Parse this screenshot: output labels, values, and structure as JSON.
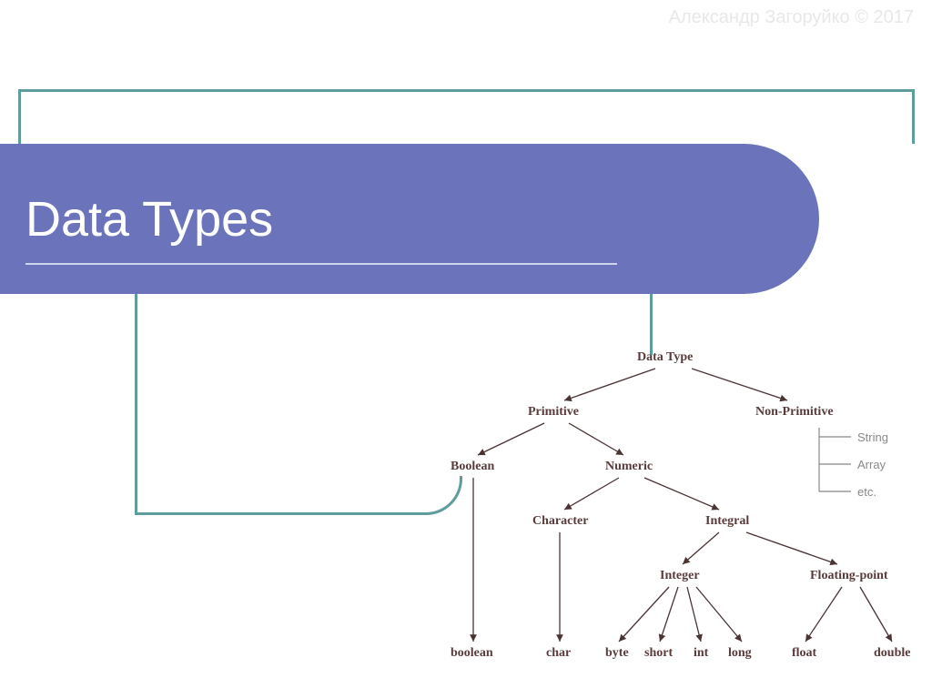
{
  "watermark": "Александр Загоруйко © 2017",
  "title": "Data Types",
  "diagram": {
    "root": "Data Type",
    "primitive": "Primitive",
    "nonprimitive": "Non-Primitive",
    "boolean_cat": "Boolean",
    "numeric": "Numeric",
    "character": "Character",
    "integral": "Integral",
    "integer": "Integer",
    "floating": "Floating-point",
    "leaf_boolean": "boolean",
    "leaf_char": "char",
    "leaf_byte": "byte",
    "leaf_short": "short",
    "leaf_int": "int",
    "leaf_long": "long",
    "leaf_float": "float",
    "leaf_double": "double",
    "np_string": "String",
    "np_array": "Array",
    "np_etc": "etc."
  },
  "chart_data": {
    "type": "tree",
    "title": "Data Types",
    "root": "Data Type",
    "children": [
      {
        "name": "Primitive",
        "children": [
          {
            "name": "Boolean",
            "children": [
              {
                "name": "boolean"
              }
            ]
          },
          {
            "name": "Numeric",
            "children": [
              {
                "name": "Character",
                "children": [
                  {
                    "name": "char"
                  }
                ]
              },
              {
                "name": "Integral",
                "children": [
                  {
                    "name": "Integer",
                    "children": [
                      {
                        "name": "byte"
                      },
                      {
                        "name": "short"
                      },
                      {
                        "name": "int"
                      },
                      {
                        "name": "long"
                      }
                    ]
                  },
                  {
                    "name": "Floating-point",
                    "children": [
                      {
                        "name": "float"
                      },
                      {
                        "name": "double"
                      }
                    ]
                  }
                ]
              }
            ]
          }
        ]
      },
      {
        "name": "Non-Primitive",
        "children": [
          {
            "name": "String"
          },
          {
            "name": "Array"
          },
          {
            "name": "etc."
          }
        ]
      }
    ]
  }
}
